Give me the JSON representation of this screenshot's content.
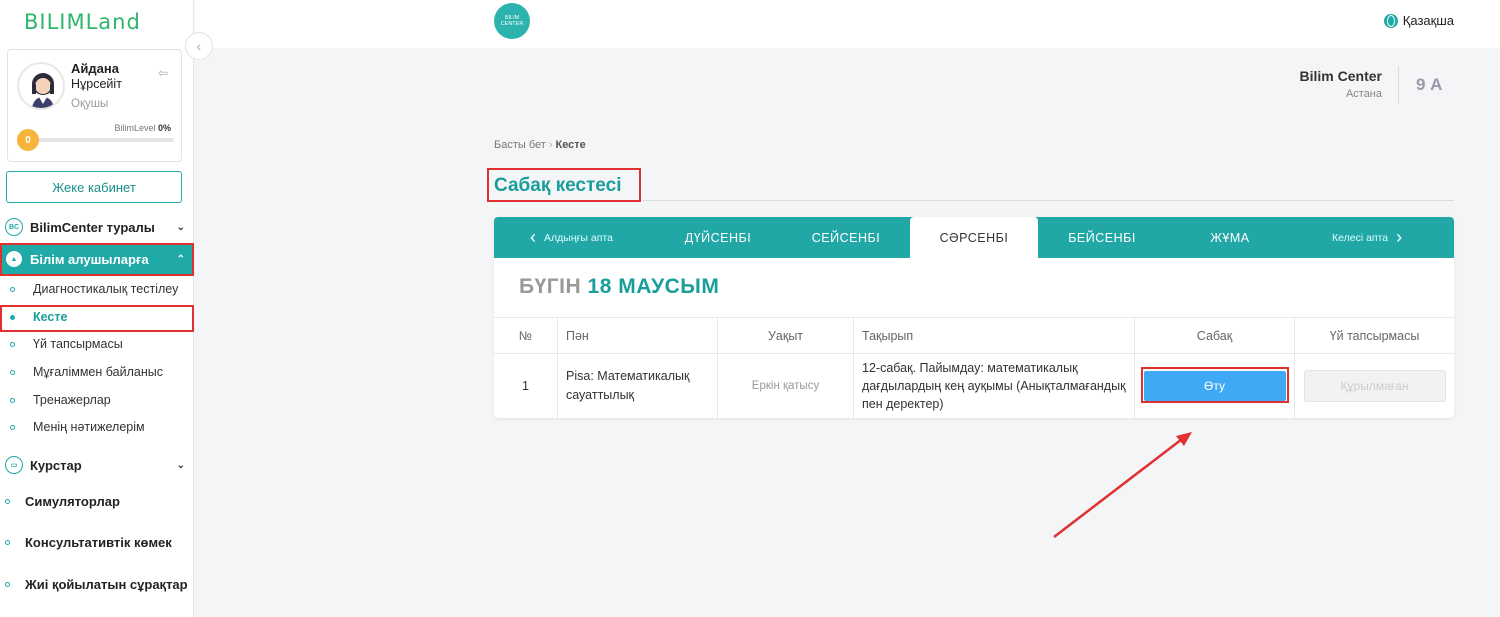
{
  "brand": {
    "logo_text": "BILIMLand",
    "center_logo_text": "BILIM CENTER"
  },
  "profile": {
    "first_name": "Айдана",
    "last_name": "Нұрсейіт",
    "role": "Оқушы",
    "level_label": "BilimLevel",
    "level_percent": "0%",
    "level_value": "0"
  },
  "sidebar": {
    "cabinet_button": "Жеке кабинет",
    "about": "BilimCenter туралы",
    "students": "Білім алушыларға",
    "sub_items": [
      "Диагностикалық тестілеу",
      "Кесте",
      "Үй тапсырмасы",
      "Мұғаліммен байланыс",
      "Тренажерлар",
      "Менің нәтижелерім"
    ],
    "courses": "Курстар",
    "simulators": "Симуляторлар",
    "consult": "Консультативтік көмек",
    "faq": "Жиі қойылатын сұрақтар"
  },
  "header": {
    "language": "Қазақша",
    "school_name": "Bilim Center",
    "school_city": "Астана",
    "class_name": "9 А"
  },
  "breadcrumb": {
    "home": "Басты бет",
    "current": "Кесте"
  },
  "page_title": "Сабақ кестесі",
  "schedule": {
    "prev_week": "Алдыңғы апта",
    "next_week": "Келесі апта",
    "days": [
      "ДҮЙСЕНБІ",
      "СЕЙСЕНБІ",
      "СӘРСЕНБІ",
      "БЕЙСЕНБІ",
      "ЖҰМА"
    ],
    "active_day": "СӘРСЕНБІ",
    "today_label": "БҮГІН",
    "today_date": "18 МАУСЫМ",
    "columns": [
      "№",
      "Пән",
      "Уақыт",
      "Тақырып",
      "Сабақ",
      "Үй тапсырмасы"
    ],
    "rows": [
      {
        "num": "1",
        "subject": "Pisa: Математикалық сауаттылық",
        "time": "Еркін қатысу",
        "topic": "12-сабақ. Пайымдау: математикалық дағдылардың кең ауқымы (Анықталмағандық пен деректер)",
        "lesson_button": "Өту",
        "homework_button": "Құрылмаған"
      }
    ]
  },
  "colors": {
    "accent": "#21a7a5",
    "go_button": "#3fa9f5",
    "highlight": "#e03030"
  }
}
